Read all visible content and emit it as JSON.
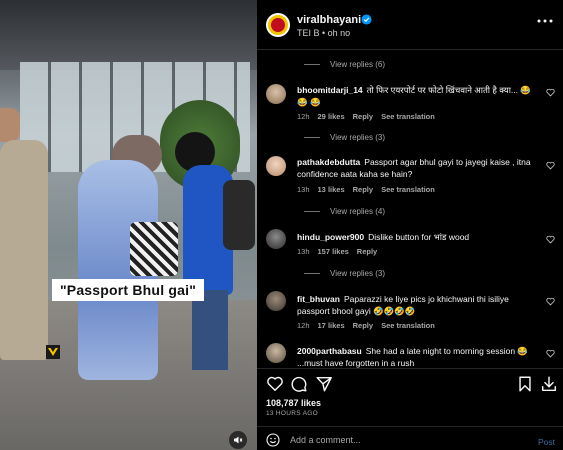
{
  "video": {
    "caption": "\"Passport Bhul gai\"",
    "mute_icon": "speaker-muted-icon"
  },
  "header": {
    "username": "viralbhayani",
    "verified_icon": "verified-badge-icon",
    "meta": "TEI B • oh no",
    "more_icon": "more-horizontal-icon"
  },
  "comments": {
    "view_replies": [
      "View replies (6)",
      "View replies (3)",
      "View replies (4)",
      "View replies (3)"
    ],
    "items": [
      {
        "username": "bhoomitdarji_14",
        "text": "तो फिर एयरपोर्ट पर फोटो खिंचवाने आती है क्या... 😂 😂 😂",
        "age": "12h",
        "likes": "29 likes",
        "reply": "Reply",
        "translate": "See translation"
      },
      {
        "username": "pathakdebdutta",
        "text": "Passport agar bhul gayi to jayegi kaise , itna confidence aata kaha se hain?",
        "age": "13h",
        "likes": "13 likes",
        "reply": "Reply",
        "translate": "See translation"
      },
      {
        "username": "hindu_power900",
        "text": "Dislike button for भांड wood",
        "age": "13h",
        "likes": "157 likes",
        "reply": "Reply",
        "translate": ""
      },
      {
        "username": "fit_bhuvan",
        "text": "Paparazzi ke liye pics jo khichwani thi isiliye passport bhool gayi 🤣🤣🤣🤣",
        "age": "12h",
        "likes": "17 likes",
        "reply": "Reply",
        "translate": "See translation"
      },
      {
        "username": "2000parthabasu",
        "text": "She had a late night to morning session 😂 ...must have forgotten in a rush",
        "age": "",
        "likes": "",
        "reply": "",
        "translate": ""
      }
    ]
  },
  "actions": {
    "like_icon": "heart-icon",
    "comment_icon": "comment-icon",
    "share_icon": "share-icon",
    "save_icon": "bookmark-icon",
    "download_icon": "download-icon"
  },
  "likes_count": "108,787 likes",
  "timestamp": "13 HOURS AGO",
  "add_comment": {
    "placeholder": "Add a comment...",
    "post_label": "Post",
    "emoji_icon": "emoji-icon"
  },
  "colors": {
    "background": "#000000",
    "text": "#f5f5f5",
    "muted": "#a8a8a8",
    "link": "#3a6f9e",
    "verified": "#0095f6",
    "brand_yellow": "#f4c400",
    "brand_red": "#c00d20"
  }
}
